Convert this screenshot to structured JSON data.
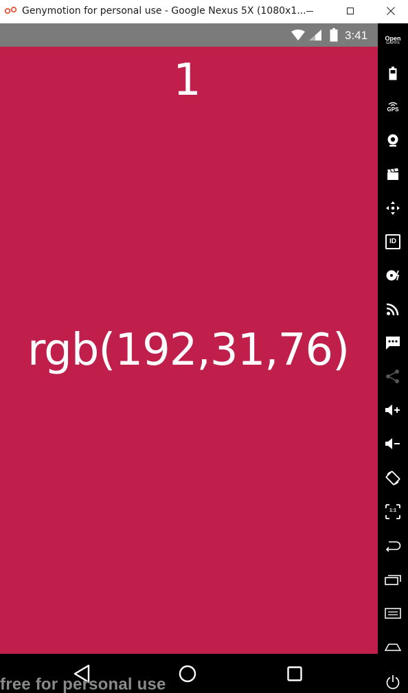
{
  "window": {
    "title": "Genymotion for personal use - Google Nexus 5X (1080x1...",
    "app_icon": "genymotion-logo-icon",
    "minimize_icon": "minimize-icon",
    "maximize_icon": "maximize-icon",
    "close_icon": "close-icon"
  },
  "status_bar": {
    "time": "3:41",
    "icons": [
      "wifi-icon",
      "cell-signal-icon",
      "battery-icon"
    ]
  },
  "app": {
    "counter": "1",
    "color_text": "rgb(192,31,76)",
    "background_color": "#c01f4c"
  },
  "nav_bar": {
    "buttons": [
      "back-icon",
      "home-icon",
      "recents-icon"
    ]
  },
  "watermark": "free for personal use",
  "toolbar": {
    "gapps_line1": "Open",
    "gapps_line2": "GAPPS",
    "gps_label": "GPS",
    "id_label": "ID",
    "pixel_ratio_label": "1:1",
    "tools": [
      "open-gapps-icon",
      "battery-icon",
      "gps-icon",
      "webcam-icon",
      "capture-icon",
      "remote-control-icon",
      "device-id-icon",
      "disk-io-icon",
      "network-icon",
      "phone-sms-icon",
      "share-icon",
      "volume-up-icon",
      "volume-down-icon",
      "rotate-icon",
      "pixel-perfect-icon",
      "back-icon",
      "recent-apps-icon",
      "menu-icon",
      "home-icon",
      "power-icon"
    ]
  }
}
